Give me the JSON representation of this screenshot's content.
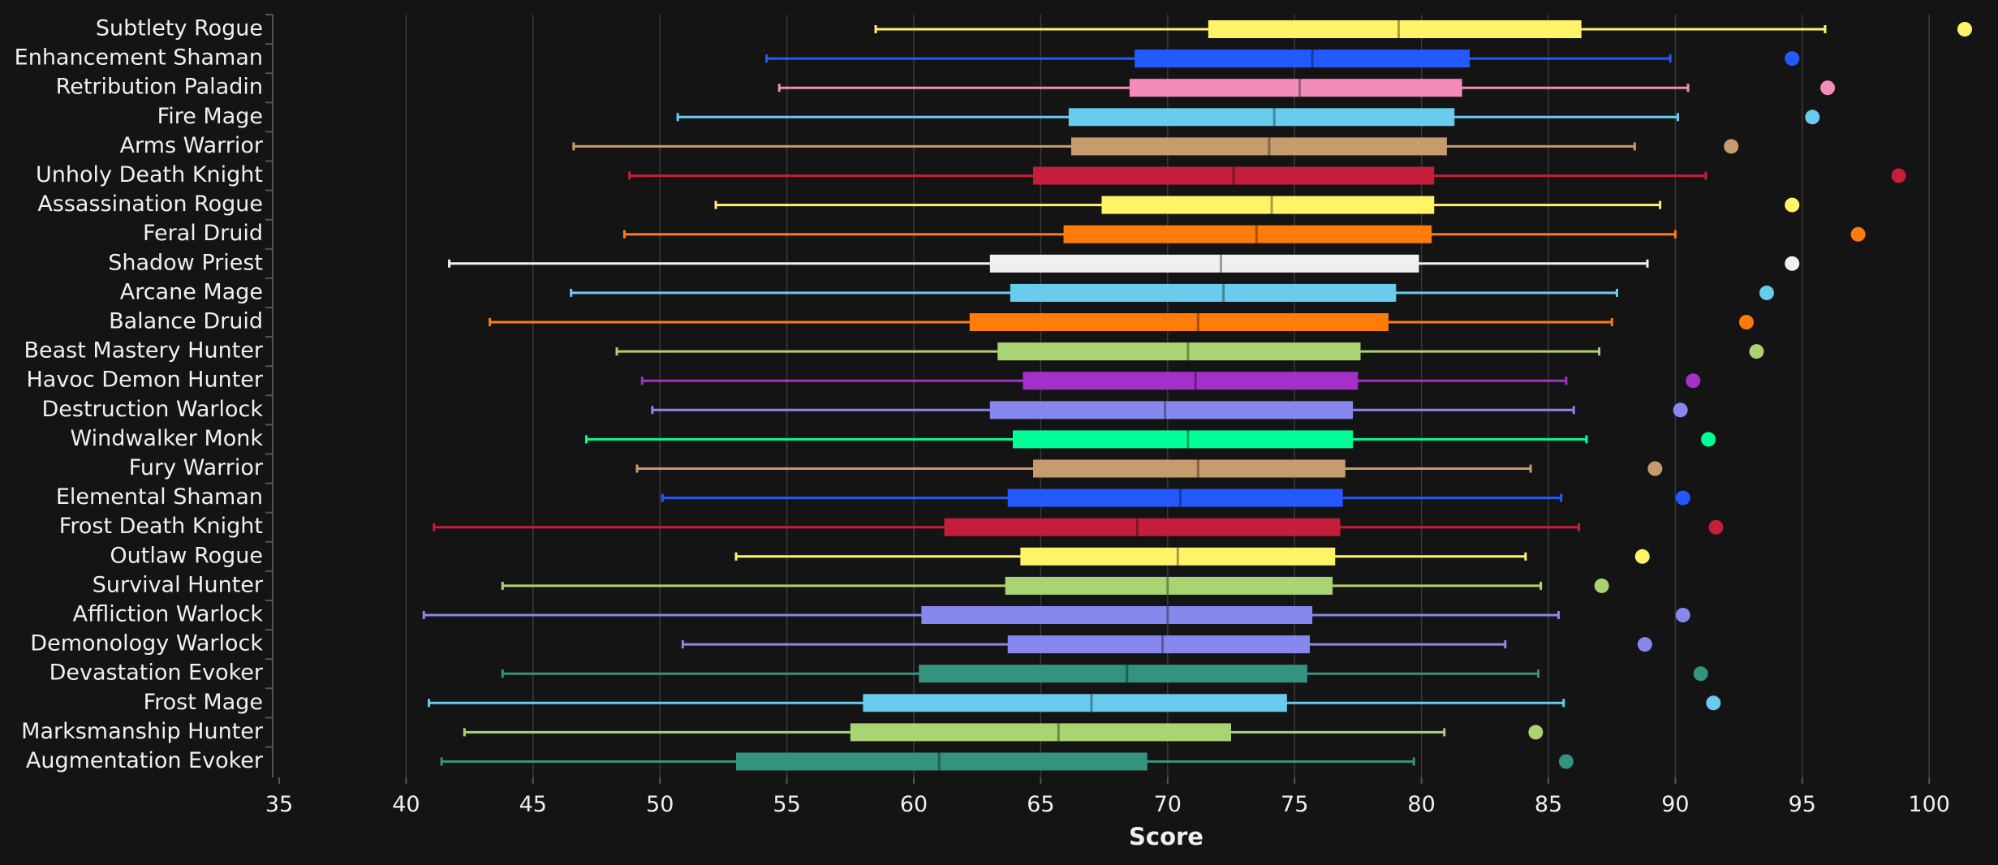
{
  "chart_data": {
    "type": "boxplot",
    "title": "",
    "xlabel": "Score",
    "ylabel": "",
    "xlim": [
      35,
      102.5
    ],
    "xticks": [
      35,
      40,
      45,
      50,
      55,
      60,
      65,
      70,
      75,
      80,
      85,
      90,
      95,
      100
    ],
    "grid": "vertical",
    "legend": "none",
    "series": [
      {
        "name": "Subtlety Rogue",
        "color": "#fff468",
        "whisker_low": 58.5,
        "q1": 71.6,
        "median": 79.1,
        "q3": 86.3,
        "whisker_high": 95.9,
        "outlier": 101.4
      },
      {
        "name": "Enhancement Shaman",
        "color": "#2359ff",
        "whisker_low": 54.2,
        "q1": 68.7,
        "median": 75.7,
        "q3": 81.9,
        "whisker_high": 89.8,
        "outlier": 94.6
      },
      {
        "name": "Retribution Paladin",
        "color": "#f48cba",
        "whisker_low": 54.7,
        "q1": 68.5,
        "median": 75.2,
        "q3": 81.6,
        "whisker_high": 90.5,
        "outlier": 96.0
      },
      {
        "name": "Fire Mage",
        "color": "#68ccef",
        "whisker_low": 50.7,
        "q1": 66.1,
        "median": 74.2,
        "q3": 81.3,
        "whisker_high": 90.1,
        "outlier": 95.4
      },
      {
        "name": "Arms Warrior",
        "color": "#c69b6d",
        "whisker_low": 46.6,
        "q1": 66.2,
        "median": 74.0,
        "q3": 81.0,
        "whisker_high": 88.4,
        "outlier": 92.2
      },
      {
        "name": "Unholy Death Knight",
        "color": "#c41e3b",
        "whisker_low": 48.8,
        "q1": 64.7,
        "median": 72.6,
        "q3": 80.5,
        "whisker_high": 91.2,
        "outlier": 98.8
      },
      {
        "name": "Assassination Rogue",
        "color": "#fff468",
        "whisker_low": 52.2,
        "q1": 67.4,
        "median": 74.1,
        "q3": 80.5,
        "whisker_high": 89.4,
        "outlier": 94.6
      },
      {
        "name": "Feral Druid",
        "color": "#ff7c0a",
        "whisker_low": 48.6,
        "q1": 65.9,
        "median": 73.5,
        "q3": 80.4,
        "whisker_high": 90.0,
        "outlier": 97.2
      },
      {
        "name": "Shadow Priest",
        "color": "#f0f0f0",
        "whisker_low": 41.7,
        "q1": 63.0,
        "median": 72.1,
        "q3": 79.9,
        "whisker_high": 88.9,
        "outlier": 94.6
      },
      {
        "name": "Arcane Mage",
        "color": "#68ccef",
        "whisker_low": 46.5,
        "q1": 63.8,
        "median": 72.2,
        "q3": 79.0,
        "whisker_high": 87.7,
        "outlier": 93.6
      },
      {
        "name": "Balance Druid",
        "color": "#ff7c0a",
        "whisker_low": 43.3,
        "q1": 62.2,
        "median": 71.2,
        "q3": 78.7,
        "whisker_high": 87.5,
        "outlier": 92.8
      },
      {
        "name": "Beast Mastery Hunter",
        "color": "#aad372",
        "whisker_low": 48.3,
        "q1": 63.3,
        "median": 70.8,
        "q3": 77.6,
        "whisker_high": 87.0,
        "outlier": 93.2
      },
      {
        "name": "Havoc Demon Hunter",
        "color": "#a330c9",
        "whisker_low": 49.3,
        "q1": 64.3,
        "median": 71.1,
        "q3": 77.5,
        "whisker_high": 85.7,
        "outlier": 90.7
      },
      {
        "name": "Destruction Warlock",
        "color": "#8788ee",
        "whisker_low": 49.7,
        "q1": 63.0,
        "median": 69.9,
        "q3": 77.3,
        "whisker_high": 86.0,
        "outlier": 90.2
      },
      {
        "name": "Windwalker Monk",
        "color": "#00ff98",
        "whisker_low": 47.1,
        "q1": 63.9,
        "median": 70.8,
        "q3": 77.3,
        "whisker_high": 86.5,
        "outlier": 91.3
      },
      {
        "name": "Fury Warrior",
        "color": "#c69b6d",
        "whisker_low": 49.1,
        "q1": 64.7,
        "median": 71.2,
        "q3": 77.0,
        "whisker_high": 84.3,
        "outlier": 89.2
      },
      {
        "name": "Elemental Shaman",
        "color": "#2359ff",
        "whisker_low": 50.1,
        "q1": 63.7,
        "median": 70.5,
        "q3": 76.9,
        "whisker_high": 85.5,
        "outlier": 90.3
      },
      {
        "name": "Frost Death Knight",
        "color": "#c41e3b",
        "whisker_low": 41.1,
        "q1": 61.2,
        "median": 68.8,
        "q3": 76.8,
        "whisker_high": 86.2,
        "outlier": 91.6
      },
      {
        "name": "Outlaw Rogue",
        "color": "#fff468",
        "whisker_low": 53.0,
        "q1": 64.2,
        "median": 70.4,
        "q3": 76.6,
        "whisker_high": 84.1,
        "outlier": 88.7
      },
      {
        "name": "Survival Hunter",
        "color": "#aad372",
        "whisker_low": 43.8,
        "q1": 63.6,
        "median": 70.0,
        "q3": 76.5,
        "whisker_high": 84.7,
        "outlier": 87.1
      },
      {
        "name": "Affliction Warlock",
        "color": "#8788ee",
        "whisker_low": 40.7,
        "q1": 60.3,
        "median": 70.0,
        "q3": 75.7,
        "whisker_high": 85.4,
        "outlier": 90.3
      },
      {
        "name": "Demonology Warlock",
        "color": "#8788ee",
        "whisker_low": 50.9,
        "q1": 63.7,
        "median": 69.8,
        "q3": 75.6,
        "whisker_high": 83.3,
        "outlier": 88.8
      },
      {
        "name": "Devastation Evoker",
        "color": "#33937f",
        "whisker_low": 43.8,
        "q1": 60.2,
        "median": 68.4,
        "q3": 75.5,
        "whisker_high": 84.6,
        "outlier": 91.0
      },
      {
        "name": "Frost Mage",
        "color": "#68ccef",
        "whisker_low": 40.9,
        "q1": 58.0,
        "median": 67.0,
        "q3": 74.7,
        "whisker_high": 85.6,
        "outlier": 91.5
      },
      {
        "name": "Marksmanship Hunter",
        "color": "#aad372",
        "whisker_low": 42.3,
        "q1": 57.5,
        "median": 65.7,
        "q3": 72.5,
        "whisker_high": 80.9,
        "outlier": 84.5
      },
      {
        "name": "Augmentation Evoker",
        "color": "#33937f",
        "whisker_low": 41.4,
        "q1": 53.0,
        "median": 61.0,
        "q3": 69.2,
        "whisker_high": 79.7,
        "outlier": 85.7
      }
    ]
  },
  "colors": {
    "background": "#141414",
    "grid": "#3a3a3a",
    "text": "#f0f0f0",
    "axis": "#555555"
  }
}
